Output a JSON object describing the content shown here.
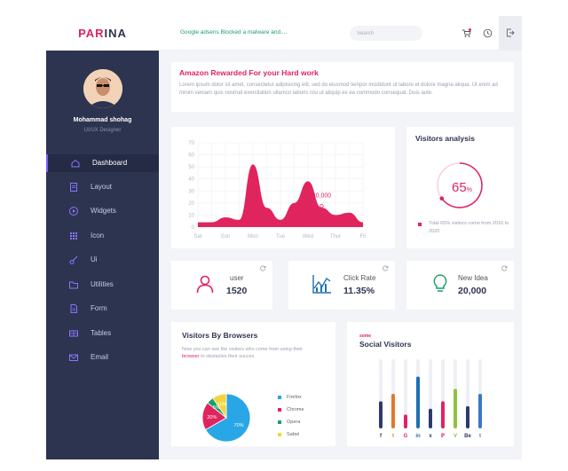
{
  "brand": {
    "part1": "PAR",
    "part2": "INA"
  },
  "colors": {
    "accent": "#e0245e",
    "sidebar": "#2d3450",
    "green": "#1b9e6a",
    "purple": "#7b5cff"
  },
  "topbar": {
    "notice": "Google adsens Blocked a malware and....",
    "search_placeholder": "Search",
    "icons": [
      "cart-icon",
      "clock-icon",
      "logout-icon"
    ]
  },
  "profile": {
    "name": "Mohammad shohag",
    "role": "UI/UX Designer"
  },
  "nav": [
    {
      "label": "Dashboard",
      "icon": "home-icon",
      "active": true
    },
    {
      "label": "Layout",
      "icon": "document-icon"
    },
    {
      "label": "Widgets",
      "icon": "widgets-icon"
    },
    {
      "label": "Icon",
      "icon": "grid-icon"
    },
    {
      "label": "Ui",
      "icon": "brush-icon"
    },
    {
      "label": "Utilities",
      "icon": "folder-icon"
    },
    {
      "label": "Form",
      "icon": "form-icon"
    },
    {
      "label": "Tables",
      "icon": "tables-icon"
    },
    {
      "label": "Email",
      "icon": "email-icon"
    }
  ],
  "amazon": {
    "title": "Amazon Rewarded For your Hard work",
    "body": "Lorem ipsum dolor sit amet, consectetur adipisicing elit, sed do eiusmod tempor incididunt ut labore et dolore magna aliqua. Ut enim ad minim veniam quis nostrud exercitation ullamco laboris nisi ut aliquip ex ea commodo consequat. Duis aute."
  },
  "chart_data": [
    {
      "type": "area",
      "categories": [
        "Sat",
        "Sun",
        "Mon",
        "Tue",
        "Wed",
        "Thur",
        "Fri"
      ],
      "yticks": [
        0,
        10,
        20,
        30,
        40,
        50,
        60,
        70
      ],
      "ylim": [
        0,
        70
      ],
      "x": [
        0,
        0.5,
        1,
        1.5,
        2,
        2.5,
        3,
        3.5,
        4,
        4.5,
        5,
        5.5,
        6
      ],
      "values": [
        4,
        4,
        8,
        6,
        52,
        16,
        6,
        20,
        38,
        16,
        10,
        12,
        4
      ],
      "color": "#e0245e",
      "annotation": {
        "label": "40,000",
        "x": 4.5
      }
    },
    {
      "type": "pie",
      "labels": [
        "Firefox",
        "Chrome",
        "Opera",
        "Safari"
      ],
      "values": [
        70,
        20,
        5,
        10
      ],
      "slice_labels": [
        "70%",
        "20%",
        "5%",
        "10%"
      ],
      "colors": [
        "#29a6e6",
        "#e0245e",
        "#1b9e6a",
        "#f2d43b"
      ]
    },
    {
      "type": "bar",
      "title": "Social Visitors",
      "categories": [
        "f",
        "t",
        "G",
        "in",
        "x",
        "ℙ",
        "V",
        "Be",
        "t"
      ],
      "icons": [
        "facebook-icon",
        "twitter-icon",
        "google-icon",
        "linkedin-icon",
        "xing-icon",
        "pinterest-icon",
        "vimeo-icon",
        "behance-icon",
        "tumblr-icon"
      ],
      "values": [
        55,
        70,
        28,
        105,
        40,
        55,
        80,
        45,
        70
      ],
      "ylim": [
        0,
        140
      ],
      "colors": [
        "#2d3a6b",
        "#e07a2d",
        "#e0245e",
        "#1f6fb5",
        "#2d3a6b",
        "#e0245e",
        "#8ac240",
        "#2d3a6b",
        "#3b77c7"
      ]
    }
  ],
  "visitors_analysis": {
    "title": "Visitors analysis",
    "value": "65",
    "unit": "%",
    "fraction": 0.65,
    "note": "Total 65% visitors come from 2016 to 2020"
  },
  "stats": {
    "user": {
      "label": "user",
      "value": "1520"
    },
    "click": {
      "label": "Click Rate",
      "value": "11.35%"
    },
    "idea": {
      "label": "New Idea",
      "value": "20,000"
    }
  },
  "browsers": {
    "title": "Visitors By Browsers",
    "desc_pre": "Now you can see the visitors who come from using their ",
    "desc_hl": "browser",
    "desc_post": " to obstacles their succes"
  },
  "social": {
    "kicker": "some",
    "title": "Social Visitors"
  }
}
